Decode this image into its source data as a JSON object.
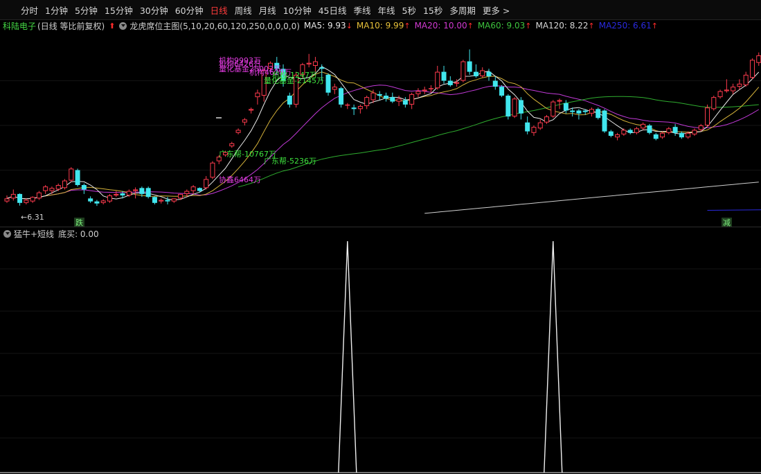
{
  "toolbar": {
    "tabs": [
      "分时",
      "1分钟",
      "5分钟",
      "15分钟",
      "30分钟",
      "60分钟",
      "日线",
      "周线",
      "月线",
      "10分钟",
      "45日线",
      "季线",
      "年线",
      "5秒",
      "15秒",
      "多周期",
      "更多 >"
    ],
    "active_tab": "日线",
    "active_color": "#ff3b3b"
  },
  "infobar": {
    "stock_name": "科陆电子",
    "mode": "(日线 等比前复权)",
    "indicator": "龙虎席位主图(5,10,20,60,120,250,0,0,0,0)",
    "ma_items": [
      {
        "label": "MA5: 9.93",
        "arrow": "↓",
        "color": "#e8e8e8"
      },
      {
        "label": "MA10: 9.99",
        "arrow": "↑",
        "color": "#e8c23a"
      },
      {
        "label": "MA20: 10.00",
        "arrow": "↑",
        "color": "#d23ad2"
      },
      {
        "label": "MA60: 9.03",
        "arrow": "↑",
        "color": "#3ec43e"
      },
      {
        "label": "MA120: 8.22",
        "arrow": "↑",
        "color": "#d8d8d8"
      },
      {
        "label": "MA250: 6.61",
        "arrow": "↑",
        "color": "#2a2ae0"
      }
    ]
  },
  "colors": {
    "up": "#ff3b4e",
    "down": "#41e6ee",
    "ma5": "#eaeaea",
    "ma10": "#d6b33a",
    "ma20": "#c23ad8",
    "ma60": "#2fae2f",
    "ma120": "#cfcfcf",
    "ma250": "#2a2ae0",
    "annot_magenta": "#e23be0",
    "annot_green": "#3ee23e"
  },
  "main_chart": {
    "annotations": [
      {
        "text": "机构9993万",
        "color": "magenta"
      },
      {
        "text": "机构6426万",
        "color": "magenta"
      },
      {
        "text": "量化基金25002万",
        "color": "magenta"
      },
      {
        "text": "机构4628万",
        "color": "magenta"
      },
      {
        "text": "机构-1247万",
        "color": "green"
      },
      {
        "text": "量化基金-2145万",
        "color": "green"
      },
      {
        "text": "广东帮-10767万",
        "color": "green"
      },
      {
        "text": "广东帮-5236万",
        "color": "green"
      },
      {
        "text": "协鑫6464万",
        "color": "magenta"
      }
    ],
    "low_price_label": "←6.31",
    "badge_left": "跌",
    "badge_right": "减"
  },
  "sub_chart": {
    "title": "猛牛+短线",
    "value_label": "底买: 0.00",
    "spikes": [
      {
        "index": 60,
        "value": 1
      },
      {
        "index": 92,
        "value": 1
      }
    ]
  },
  "chart_data": {
    "type": "candlestick",
    "candles": [
      [
        6.45,
        6.65,
        6.55,
        6.4
      ],
      [
        6.55,
        6.85,
        6.7,
        6.48
      ],
      [
        6.7,
        6.72,
        6.4,
        6.31
      ],
      [
        6.4,
        6.55,
        6.5,
        6.35
      ],
      [
        6.45,
        6.62,
        6.6,
        6.4
      ],
      [
        6.55,
        6.8,
        6.75,
        6.5
      ],
      [
        6.8,
        7.0,
        6.95,
        6.7
      ],
      [
        6.8,
        6.95,
        6.9,
        6.7
      ],
      [
        6.85,
        7.05,
        7.0,
        6.8
      ],
      [
        6.9,
        7.2,
        7.15,
        6.85
      ],
      [
        7.15,
        7.6,
        7.55,
        7.1
      ],
      [
        7.5,
        7.55,
        7.0,
        6.95
      ],
      [
        7.0,
        7.05,
        6.85,
        6.7
      ],
      [
        6.55,
        6.62,
        6.45,
        6.4
      ],
      [
        6.45,
        6.5,
        6.38,
        6.3
      ],
      [
        6.4,
        6.52,
        6.48,
        6.35
      ],
      [
        6.45,
        6.7,
        6.65,
        6.4
      ],
      [
        6.65,
        6.8,
        6.7,
        6.6
      ],
      [
        6.72,
        6.8,
        6.65,
        6.55
      ],
      [
        6.65,
        6.85,
        6.8,
        6.6
      ],
      [
        6.8,
        6.92,
        6.85,
        6.55
      ],
      [
        6.9,
        6.95,
        6.7,
        6.6
      ],
      [
        6.9,
        6.95,
        6.6,
        6.55
      ],
      [
        6.6,
        6.62,
        6.4,
        6.35
      ],
      [
        6.45,
        6.55,
        6.5,
        6.38
      ],
      [
        6.5,
        6.6,
        6.45,
        6.35
      ],
      [
        6.45,
        6.55,
        6.55,
        6.4
      ],
      [
        6.55,
        6.7,
        6.7,
        6.5
      ],
      [
        6.7,
        6.85,
        6.8,
        6.6
      ],
      [
        6.8,
        7.0,
        6.95,
        6.7
      ],
      [
        6.9,
        6.92,
        6.8,
        6.75
      ],
      [
        6.9,
        7.3,
        7.2,
        6.85
      ],
      [
        7.25,
        7.8,
        7.75,
        7.2
      ],
      [
        7.8,
        8.0,
        7.95,
        7.7
      ],
      [
        8.0,
        8.15,
        8.1,
        7.95
      ],
      [
        8.3,
        8.45,
        8.4,
        8.25
      ],
      [
        8.75,
        8.9,
        8.85,
        8.7
      ],
      [
        9.1,
        9.25,
        9.2,
        9.0
      ],
      [
        9.5,
        9.6,
        9.55,
        9.4
      ],
      [
        9.95,
        10.2,
        10.1,
        9.7
      ],
      [
        10.0,
        10.9,
        10.85,
        9.8
      ],
      [
        10.9,
        11.15,
        11.1,
        10.85
      ],
      [
        11.1,
        11.3,
        10.9,
        10.7
      ],
      [
        10.9,
        11.05,
        10.5,
        10.3
      ],
      [
        10.0,
        10.1,
        9.7,
        9.6
      ],
      [
        9.7,
        10.8,
        10.7,
        9.6
      ],
      [
        10.7,
        11.1,
        11.05,
        10.6
      ],
      [
        11.05,
        11.4,
        11.1,
        10.95
      ],
      [
        11.0,
        11.3,
        11.15,
        10.8
      ],
      [
        10.95,
        11.05,
        10.9,
        10.5
      ],
      [
        10.7,
        10.75,
        10.1,
        10.0
      ],
      [
        10.2,
        10.4,
        10.3,
        10.05
      ],
      [
        10.25,
        10.3,
        9.7,
        9.6
      ],
      [
        9.7,
        9.75,
        9.7,
        9.55
      ],
      [
        9.6,
        9.7,
        9.55,
        9.35
      ],
      [
        9.55,
        9.7,
        9.65,
        9.4
      ],
      [
        9.65,
        10.0,
        9.95,
        9.55
      ],
      [
        9.85,
        10.2,
        10.1,
        9.75
      ],
      [
        10.05,
        10.15,
        10.0,
        9.85
      ],
      [
        10.0,
        10.1,
        9.9,
        9.8
      ],
      [
        9.95,
        10.1,
        9.8,
        9.75
      ],
      [
        9.8,
        10.0,
        9.9,
        9.65
      ],
      [
        9.85,
        9.95,
        9.7,
        9.6
      ],
      [
        9.7,
        10.1,
        10.05,
        9.55
      ],
      [
        10.05,
        10.25,
        10.15,
        9.95
      ],
      [
        10.15,
        10.3,
        10.2,
        10.05
      ],
      [
        10.25,
        10.35,
        10.25,
        10.1
      ],
      [
        10.25,
        11.0,
        10.8,
        10.2
      ],
      [
        10.8,
        11.0,
        10.5,
        10.4
      ],
      [
        10.5,
        10.65,
        10.35,
        10.3
      ],
      [
        10.4,
        10.55,
        10.45,
        10.3
      ],
      [
        10.5,
        11.2,
        11.15,
        10.45
      ],
      [
        11.15,
        11.55,
        10.8,
        10.7
      ],
      [
        10.8,
        11.05,
        10.65,
        10.6
      ],
      [
        10.65,
        10.95,
        10.85,
        10.6
      ],
      [
        10.8,
        10.9,
        10.65,
        10.5
      ],
      [
        10.5,
        10.65,
        10.3,
        10.2
      ],
      [
        10.3,
        10.35,
        10.0,
        9.95
      ],
      [
        10.0,
        10.05,
        9.3,
        9.2
      ],
      [
        9.3,
        9.95,
        9.9,
        9.25
      ],
      [
        9.85,
        9.95,
        9.4,
        9.2
      ],
      [
        9.1,
        9.3,
        8.8,
        8.7
      ],
      [
        8.75,
        9.0,
        8.95,
        8.65
      ],
      [
        8.9,
        9.2,
        9.1,
        8.85
      ],
      [
        9.1,
        9.35,
        9.3,
        9.05
      ],
      [
        9.3,
        9.85,
        9.8,
        9.25
      ],
      [
        9.8,
        9.9,
        9.85,
        9.55
      ],
      [
        9.75,
        9.85,
        9.5,
        9.4
      ],
      [
        9.5,
        9.6,
        9.45,
        9.3
      ],
      [
        9.5,
        9.55,
        9.4,
        9.2
      ],
      [
        9.5,
        9.55,
        9.45,
        9.35
      ],
      [
        9.4,
        9.6,
        9.55,
        9.3
      ],
      [
        9.55,
        9.6,
        9.25,
        9.2
      ],
      [
        9.5,
        9.55,
        8.8,
        8.75
      ],
      [
        8.8,
        8.85,
        8.65,
        8.6
      ],
      [
        8.6,
        8.75,
        8.7,
        8.5
      ],
      [
        8.7,
        8.9,
        8.85,
        8.65
      ],
      [
        8.85,
        8.9,
        8.75,
        8.7
      ],
      [
        8.75,
        8.95,
        8.9,
        8.7
      ],
      [
        8.9,
        9.1,
        9.05,
        8.85
      ],
      [
        9.0,
        9.05,
        8.75,
        8.7
      ],
      [
        8.7,
        8.75,
        8.55,
        8.5
      ],
      [
        8.6,
        8.8,
        8.75,
        8.55
      ],
      [
        8.75,
        8.95,
        8.9,
        8.7
      ],
      [
        8.95,
        9.05,
        8.75,
        8.65
      ],
      [
        8.75,
        8.8,
        8.6,
        8.55
      ],
      [
        8.6,
        8.8,
        8.75,
        8.55
      ],
      [
        8.7,
        8.9,
        8.85,
        8.65
      ],
      [
        8.85,
        9.05,
        9.0,
        8.8
      ],
      [
        9.0,
        9.7,
        9.6,
        8.95
      ],
      [
        9.55,
        10.0,
        9.95,
        9.5
      ],
      [
        9.95,
        10.2,
        10.15,
        9.9
      ],
      [
        10.15,
        10.55,
        10.2,
        10.1
      ],
      [
        10.15,
        10.4,
        10.3,
        10.05
      ],
      [
        10.3,
        10.55,
        10.4,
        10.2
      ],
      [
        10.35,
        10.8,
        10.7,
        10.3
      ],
      [
        10.6,
        11.25,
        11.2,
        10.55
      ],
      [
        11.1,
        11.45,
        11.35,
        11.0
      ]
    ]
  }
}
